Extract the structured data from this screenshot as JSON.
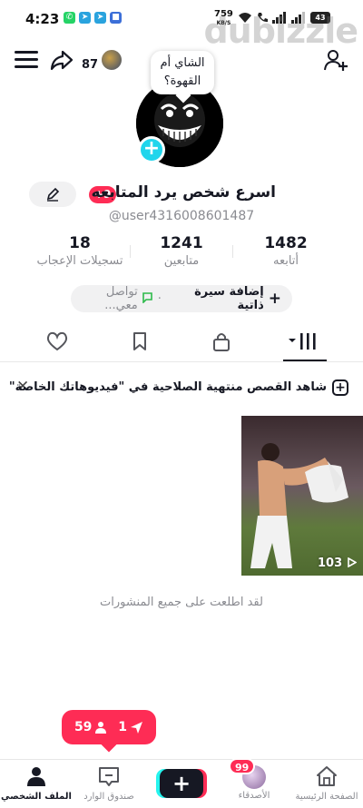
{
  "status_bar": {
    "time": "4:23",
    "speed_value": "759",
    "speed_unit": "KB/S",
    "battery": "43",
    "app_icons": [
      "whatsapp-icon",
      "telegram-icon",
      "telegram-icon",
      "chat-icon"
    ]
  },
  "watermark": "dubizzle",
  "top_bar": {
    "visitor_count": "87"
  },
  "profile": {
    "bubble_text": "الشاي أم القهوة؟",
    "name_badge": "+9",
    "display_name": "اسرع شخص يرد المتابعه",
    "username": "@user4316008601487"
  },
  "stats": [
    {
      "number": "1482",
      "label": "أتابعه"
    },
    {
      "number": "1241",
      "label": "متابعين"
    },
    {
      "number": "18",
      "label": "تسجيلات الإعجاب"
    }
  ],
  "bio_chip": {
    "add_bio": "إضافة سيرة ذاتية",
    "contact": "تواصل معي..."
  },
  "tabs": [
    "videos-grid-icon",
    "lock-icon",
    "bookmark-icon",
    "heart-icon"
  ],
  "banner": {
    "text": "شاهد القصص منتهية الصلاحية في \"فيديوهاتك الخاصة\""
  },
  "video": {
    "views": "103"
  },
  "all_seen_text": "لقد اطلعت على جميع المنشورات",
  "notification": {
    "messages": "1",
    "followers": "59"
  },
  "bottom_nav": {
    "home": "الصفحة الرئيسية",
    "friends": "الأصدقاء",
    "friends_badge": "99",
    "inbox": "صندوق الوارد",
    "profile": "الملف الشخصي"
  },
  "colors": {
    "accent_red": "#fe2c55",
    "accent_cyan": "#20d5ec",
    "text_primary": "#161823",
    "text_secondary": "#8a8b91"
  }
}
